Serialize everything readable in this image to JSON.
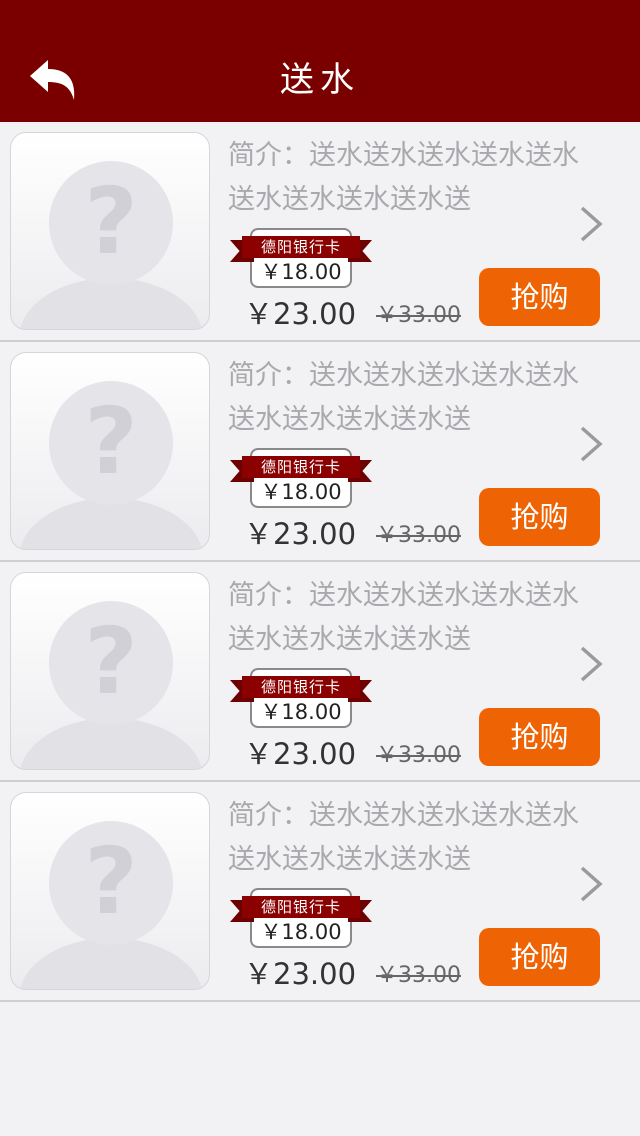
{
  "header": {
    "title": "送水",
    "back_icon": "back-arrow-icon"
  },
  "colors": {
    "header_bg": "#7a0000",
    "buy_button": "#ee6404",
    "ribbon": "#8b0000"
  },
  "items": [
    {
      "description": "简介：送水送水送水送水送水送水送水送水送水送",
      "card_label": "德阳银行卡",
      "card_price": "￥18.00",
      "price": "￥23.00",
      "original_price": "￥33.00",
      "buy_label": "抢购"
    },
    {
      "description": "简介：送水送水送水送水送水送水送水送水送水送",
      "card_label": "德阳银行卡",
      "card_price": "￥18.00",
      "price": "￥23.00",
      "original_price": "￥33.00",
      "buy_label": "抢购"
    },
    {
      "description": "简介：送水送水送水送水送水送水送水送水送水送",
      "card_label": "德阳银行卡",
      "card_price": "￥18.00",
      "price": "￥23.00",
      "original_price": "￥33.00",
      "buy_label": "抢购"
    },
    {
      "description": "简介：送水送水送水送水送水送水送水送水送水送",
      "card_label": "德阳银行卡",
      "card_price": "￥18.00",
      "price": "￥23.00",
      "original_price": "￥33.00",
      "buy_label": "抢购"
    }
  ]
}
